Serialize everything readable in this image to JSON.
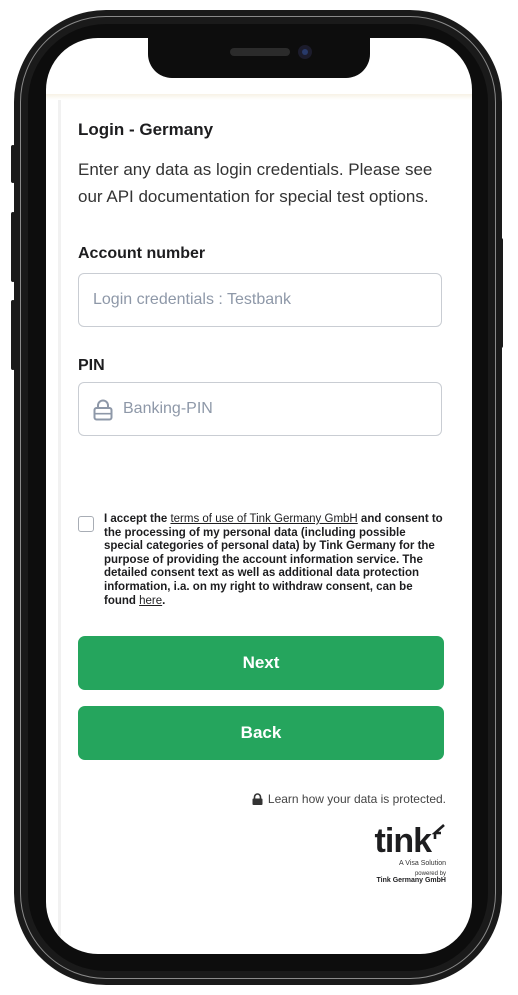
{
  "login": {
    "title": "Login - Germany",
    "subtitle": "Enter any data as login credentials. Please see our API documentation for special test options."
  },
  "fields": {
    "account_label": "Account number",
    "account_placeholder": "Login credentials : Testbank",
    "account_value": "",
    "pin_label": "PIN",
    "pin_placeholder": "Banking-PIN",
    "pin_value": ""
  },
  "consent": {
    "checked": false,
    "text_before_link": "I accept the ",
    "terms_link": "terms of use of Tink Germany GmbH",
    "text_after_link": " and consent to the processing of my personal data (including possible special categories of personal data) by Tink Germany for the purpose of providing the account information service. The detailed consent text as well as additional data protection information, i.a. on my right to withdraw consent, can be found ",
    "here_link": "here",
    "text_end": "."
  },
  "buttons": {
    "next_label": "Next",
    "back_label": "Back"
  },
  "footer": {
    "protection_text": "Learn how your data is protected.",
    "brand_name": "tink",
    "brand_tagline": "A Visa Solution",
    "powered_by": "powered by",
    "company": "Tink Germany GmbH"
  },
  "icons": [
    "lock-icon",
    "padlock-icon",
    "tink-logo-icon"
  ],
  "colors": {
    "primary_button": "#25a55d",
    "input_border": "#c9cdd3",
    "placeholder": "#8e98a8",
    "text": "#1d1d1f"
  }
}
